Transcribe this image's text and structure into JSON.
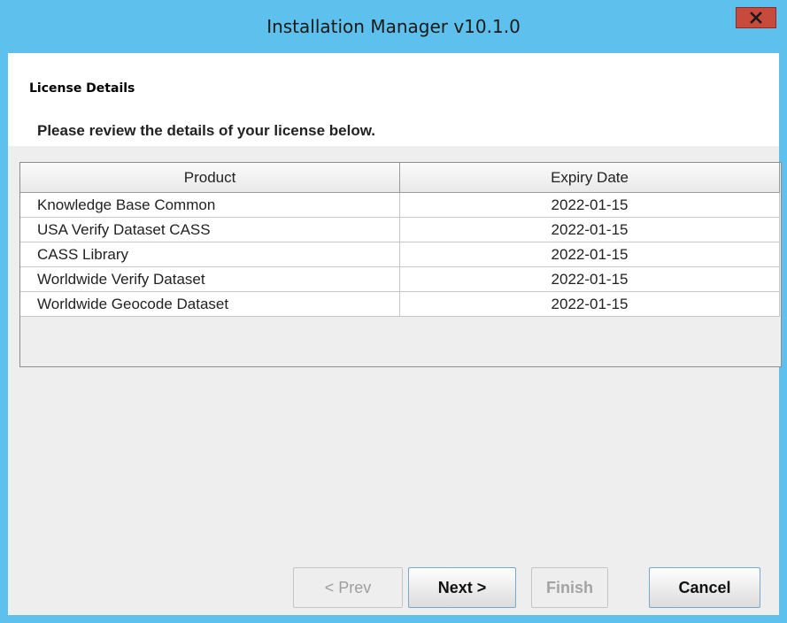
{
  "window": {
    "title": "Installation Manager v10.1.0",
    "close_icon": "close-icon",
    "titlebar_color": "#5ec0ec",
    "close_color": "#c74a3d"
  },
  "header": {
    "title": "License Details",
    "description": "Please review the details of your license below."
  },
  "table": {
    "columns": [
      "Product",
      "Expiry Date"
    ],
    "rows": [
      {
        "product": "Knowledge Base Common",
        "expiry": "2022-01-15"
      },
      {
        "product": "USA Verify Dataset CASS",
        "expiry": "2022-01-15"
      },
      {
        "product": "CASS Library",
        "expiry": "2022-01-15"
      },
      {
        "product": "Worldwide Verify Dataset",
        "expiry": "2022-01-15"
      },
      {
        "product": "Worldwide Geocode Dataset",
        "expiry": "2022-01-15"
      }
    ]
  },
  "buttons": {
    "prev": {
      "label": "< Prev",
      "enabled": false
    },
    "next": {
      "label": "Next >",
      "enabled": true
    },
    "finish": {
      "label": "Finish",
      "enabled": false
    },
    "cancel": {
      "label": "Cancel",
      "enabled": true
    }
  }
}
